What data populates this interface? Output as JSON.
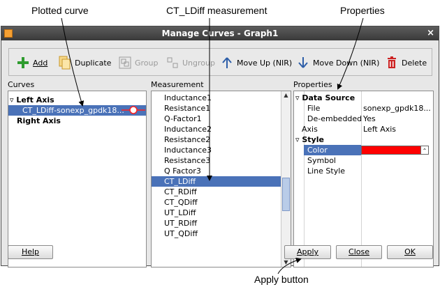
{
  "annotations": {
    "plotted_curve": "Plotted curve",
    "measurement": "CT_LDiff measurement",
    "properties": "Properties",
    "apply_button": "Apply button"
  },
  "window": {
    "title": "Manage Curves - Graph1",
    "close": "×"
  },
  "toolbar": {
    "add": "Add",
    "duplicate": "Duplicate",
    "group": "Group",
    "ungroup": "Ungroup",
    "move_up": "Move Up (NIR)",
    "move_down": "Move Down (NIR)",
    "delete": "Delete"
  },
  "curves": {
    "label": "Curves",
    "left_axis": "Left Axis",
    "curve_item": "CT_LDiff-sonexp_gpdk18...",
    "right_axis": "Right Axis"
  },
  "measurement": {
    "label": "Measurement",
    "items": [
      "Inductance1",
      "Resistance1",
      "Q-Factor1",
      "Inductance2",
      "Resistance2",
      "Inductance3",
      "Resistance3",
      "Q Factor3",
      "CT_LDiff",
      "CT_RDiff",
      "CT_QDiff",
      "UT_LDiff",
      "UT_RDiff",
      "UT_QDiff"
    ],
    "selected_index": 8
  },
  "properties": {
    "label": "Properties",
    "data_source": "Data Source",
    "file_key": "File",
    "file_val": "sonexp_gpdk18...",
    "deembedded_key": "De-embedded",
    "deembedded_val": "Yes",
    "axis_key": "Axis",
    "axis_val": "Left Axis",
    "style": "Style",
    "color_key": "Color",
    "symbol_key": "Symbol",
    "line_style_key": "Line Style"
  },
  "buttons": {
    "help": "Help",
    "apply": "Apply",
    "close": "Close",
    "ok": "OK"
  },
  "colors": {
    "selection": "#4a72b8",
    "curve_color": "#ff0000",
    "add_icon": "#2e9b2e",
    "delete_icon": "#cc2222",
    "arrow_icon": "#2d5ea8"
  }
}
